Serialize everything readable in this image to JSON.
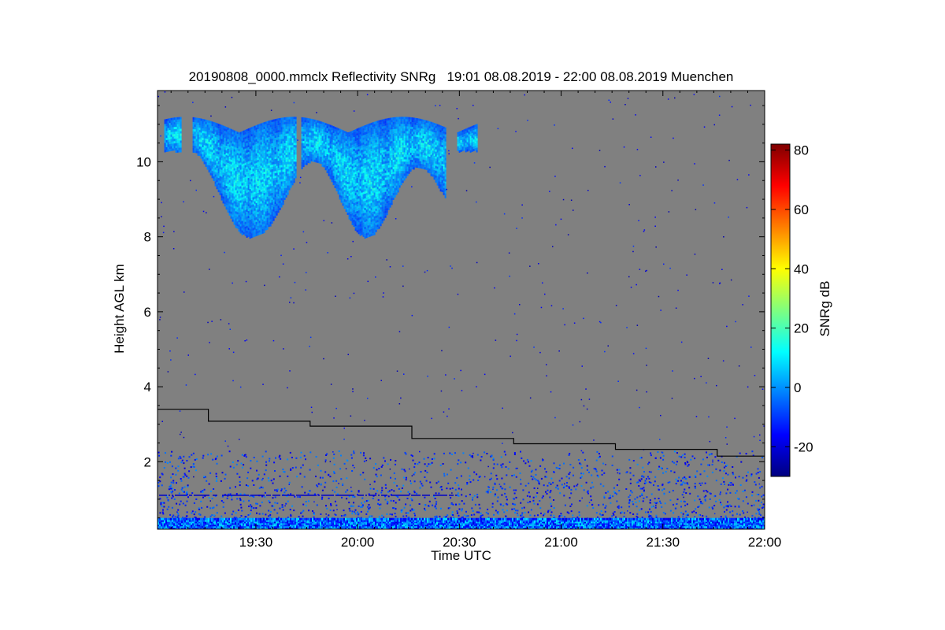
{
  "chart_data": {
    "type": "heatmap",
    "title": "20190808_0000.mmclx Reflectivity SNRg   19:01 08.08.2019 - 22:00 08.08.2019 Muenchen",
    "xlabel": "Time UTC",
    "ylabel": "Height AGL km",
    "x_ticks": [
      "19:30",
      "20:00",
      "20:30",
      "21:00",
      "21:30",
      "22:00"
    ],
    "x_tick_minutes": [
      1170,
      1200,
      1230,
      1260,
      1290,
      1320
    ],
    "xlim_minutes": [
      1141,
      1320
    ],
    "y_ticks": [
      2,
      4,
      6,
      8,
      10
    ],
    "ylim": [
      0.2,
      11.9
    ],
    "colorbar": {
      "label": "SNRg dB",
      "ticks": [
        -20,
        0,
        20,
        40,
        60,
        80
      ],
      "range": [
        -30,
        82
      ],
      "colormap": [
        "#00007f",
        "#0000ff",
        "#007fff",
        "#00ffff",
        "#7fff7f",
        "#ffff00",
        "#ff7f00",
        "#ff0000",
        "#7f0000"
      ]
    },
    "background_color": "#808080",
    "black_line": {
      "name": "",
      "x_minutes": [
        1141,
        1156,
        1156,
        1186,
        1186,
        1216,
        1216,
        1246,
        1246,
        1276,
        1276,
        1306,
        1306,
        1320
      ],
      "height_km": [
        3.4,
        3.4,
        3.08,
        3.08,
        2.95,
        2.95,
        2.62,
        2.62,
        2.48,
        2.48,
        2.33,
        2.33,
        2.15,
        2.15
      ]
    },
    "cloud_layer": {
      "x_start_minutes": 1143,
      "x_end_minutes": 1235,
      "base_km_range": [
        8.0,
        10.4
      ],
      "top_km_range": [
        10.5,
        11.2
      ],
      "snr_db_range": [
        -15,
        15
      ]
    },
    "ground_clutter": {
      "height_km_range": [
        0.2,
        2.3
      ],
      "snr_db_range": [
        -20,
        20
      ]
    }
  }
}
